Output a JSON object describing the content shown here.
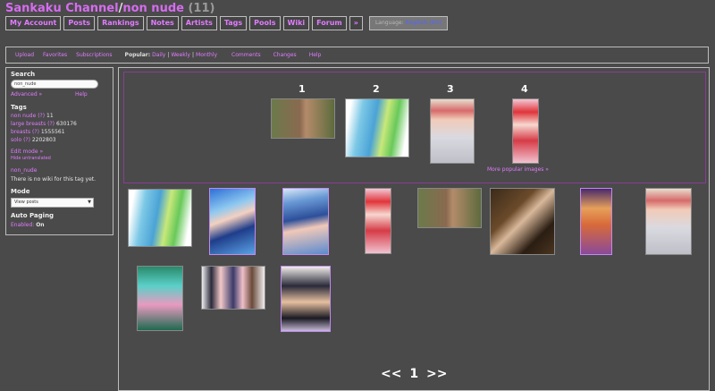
{
  "header": {
    "site_name": "Sankaku Channel",
    "separator": "/",
    "tag_name": "non nude",
    "count": "(11)"
  },
  "main_nav": [
    {
      "label": "My Account"
    },
    {
      "label": "Posts"
    },
    {
      "label": "Rankings"
    },
    {
      "label": "Notes"
    },
    {
      "label": "Artists"
    },
    {
      "label": "Tags"
    },
    {
      "label": "Pools"
    },
    {
      "label": "Wiki"
    },
    {
      "label": "Forum"
    },
    {
      "label": "»"
    }
  ],
  "language": {
    "prefix": "Language:",
    "value": "English (En)"
  },
  "sub_nav": {
    "upload": "Upload",
    "favorites": "Favorites",
    "subscriptions": "Subscriptions",
    "popular_label": "Popular:",
    "popular_daily": "Daily",
    "popular_weekly": "Weekly",
    "popular_monthly": "Monthly",
    "comments": "Comments",
    "changes": "Changes",
    "help": "Help"
  },
  "sidebar": {
    "search_heading": "Search",
    "search_value": "non_nude",
    "advanced_link": "Advanced »",
    "help_link": "Help",
    "tags_heading": "Tags",
    "tags": [
      {
        "name": "non nude",
        "q": "(?)",
        "count": "11"
      },
      {
        "name": "large breasts",
        "q": "(?)",
        "count": "630176"
      },
      {
        "name": "breasts",
        "q": "(?)",
        "count": "1555561"
      },
      {
        "name": "solo",
        "q": "(?)",
        "count": "2202803"
      }
    ],
    "edit_mode": "Edit mode »",
    "hide_untranslated": "Hide untranslated",
    "wiki_title": "non_nude",
    "wiki_text": "There is no wiki for this tag yet.",
    "mode_heading": "Mode",
    "mode_value": "View posts",
    "autopaging_heading": "Auto Paging",
    "autopaging_label": "Enabled:",
    "autopaging_value": "On"
  },
  "popular": {
    "ranks": [
      "1",
      "2",
      "3",
      "4"
    ],
    "more_link": "More popular images »"
  },
  "pager": {
    "prev": "<<",
    "page": "1",
    "next": ">>"
  }
}
